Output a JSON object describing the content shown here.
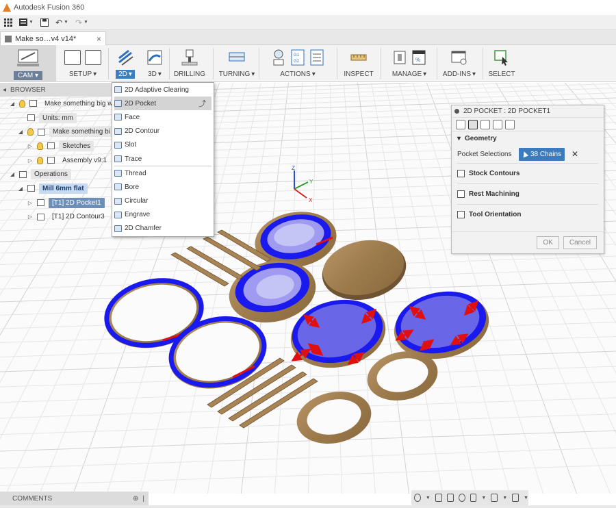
{
  "window": {
    "title": "Autodesk Fusion 360"
  },
  "quick_access": {
    "items": [
      "grid-icon",
      "save-icon",
      "undo-icon",
      "redo-icon"
    ]
  },
  "document_tab": {
    "name": "Make so…v4 v14*",
    "close": "×"
  },
  "ribbon": {
    "workspace": "CAM",
    "groups": [
      {
        "label": "SETUP",
        "dropdown": true
      },
      {
        "label": "2D",
        "dropdown": true,
        "active": true
      },
      {
        "label": "3D",
        "dropdown": true
      },
      {
        "label": "DRILLING",
        "dropdown": false
      },
      {
        "label": "TURNING",
        "dropdown": true
      },
      {
        "label": "ACTIONS",
        "dropdown": true
      },
      {
        "label": "INSPECT",
        "dropdown": false
      },
      {
        "label": "MANAGE",
        "dropdown": true
      },
      {
        "label": "ADD-INS",
        "dropdown": true
      },
      {
        "label": "SELECT",
        "dropdown": false
      }
    ]
  },
  "browser": {
    "title": "BROWSER",
    "items": [
      {
        "label": "Make something big w",
        "level": 0,
        "expand": "◢",
        "style": "plain"
      },
      {
        "label": "Units: mm",
        "level": 1,
        "expand": "",
        "style": "pill"
      },
      {
        "label": "Make something bi",
        "level": 1,
        "expand": "◢",
        "style": "pill"
      },
      {
        "label": "Sketches",
        "level": 2,
        "expand": "▷",
        "style": "pill"
      },
      {
        "label": "Assembly v9:1",
        "level": 2,
        "expand": "▷",
        "style": "plain"
      },
      {
        "label": "Operations",
        "level": 0,
        "expand": "◢",
        "style": "pill"
      },
      {
        "label": "Mill 6mm flat",
        "level": 1,
        "expand": "◢",
        "style": "blue"
      },
      {
        "label": "[T1] 2D Pocket1",
        "level": 2,
        "expand": "▷",
        "style": "sel"
      },
      {
        "label": "[T1] 2D Contour3",
        "level": 2,
        "expand": "▷",
        "style": "plain"
      }
    ]
  },
  "dropdown_2d": {
    "items": [
      {
        "label": "2D Adaptive Clearing",
        "highlighted": false
      },
      {
        "label": "2D Pocket",
        "highlighted": true
      },
      {
        "label": "Face",
        "highlighted": false
      },
      {
        "label": "2D Contour",
        "highlighted": false
      },
      {
        "label": "Slot",
        "highlighted": false
      },
      {
        "label": "Trace",
        "highlighted": false
      },
      {
        "label": "Thread",
        "highlighted": false
      },
      {
        "label": "Bore",
        "highlighted": false
      },
      {
        "label": "Circular",
        "highlighted": false
      },
      {
        "label": "Engrave",
        "highlighted": false
      },
      {
        "label": "2D Chamfer",
        "highlighted": false
      }
    ]
  },
  "property_panel": {
    "title": "2D POCKET : 2D POCKET1",
    "geometry_label": "Geometry",
    "pocket_selections_label": "Pocket Selections",
    "chains_label": "38 Chains",
    "clear": "✕",
    "checks": [
      {
        "label": "Stock Contours",
        "checked": false
      },
      {
        "label": "Rest Machining",
        "checked": false
      },
      {
        "label": "Tool Orientation",
        "checked": false
      }
    ],
    "ok": "OK",
    "cancel": "Cancel"
  },
  "triad": {
    "x": "X",
    "y": "Y",
    "z": "Z"
  },
  "comments": {
    "label": "COMMENTS"
  },
  "colors": {
    "accent": "#3c7fc0",
    "toolpath_blue": "#1a1aee",
    "wood": "#a88455",
    "arrow_red": "#e01010"
  }
}
